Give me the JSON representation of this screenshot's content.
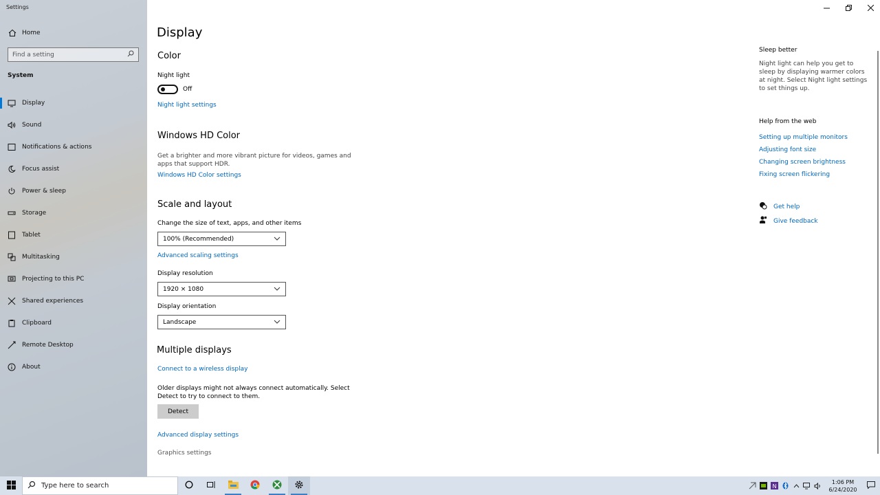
{
  "window": {
    "title": "Settings"
  },
  "sidebar": {
    "home_label": "Home",
    "search_placeholder": "Find a setting",
    "section_label": "System",
    "items": [
      {
        "label": "Display",
        "icon": "monitor-icon",
        "active": true
      },
      {
        "label": "Sound",
        "icon": "speaker-icon"
      },
      {
        "label": "Notifications & actions",
        "icon": "notification-icon"
      },
      {
        "label": "Focus assist",
        "icon": "moon-icon"
      },
      {
        "label": "Power & sleep",
        "icon": "power-icon"
      },
      {
        "label": "Storage",
        "icon": "storage-icon"
      },
      {
        "label": "Tablet",
        "icon": "tablet-icon"
      },
      {
        "label": "Multitasking",
        "icon": "multitasking-icon"
      },
      {
        "label": "Projecting to this PC",
        "icon": "projecting-icon"
      },
      {
        "label": "Shared experiences",
        "icon": "shared-icon"
      },
      {
        "label": "Clipboard",
        "icon": "clipboard-icon"
      },
      {
        "label": "Remote Desktop",
        "icon": "remote-icon"
      },
      {
        "label": "About",
        "icon": "info-icon"
      }
    ]
  },
  "main": {
    "page_title": "Display",
    "color": {
      "heading": "Color",
      "night_light_label": "Night light",
      "night_light_state": "Off",
      "night_light_link": "Night light settings"
    },
    "hd_color": {
      "heading": "Windows HD Color",
      "description": "Get a brighter and more vibrant picture for videos, games and apps that support HDR.",
      "link": "Windows HD Color settings"
    },
    "scale": {
      "heading": "Scale and layout",
      "size_label": "Change the size of text, apps, and other items",
      "size_value": "100% (Recommended)",
      "advanced_link": "Advanced scaling settings",
      "resolution_label": "Display resolution",
      "resolution_value": "1920 × 1080",
      "orientation_label": "Display orientation",
      "orientation_value": "Landscape"
    },
    "multiple": {
      "heading": "Multiple displays",
      "wireless_link": "Connect to a wireless display",
      "description": "Older displays might not always connect automatically. Select Detect to try to connect to them.",
      "detect_label": "Detect",
      "advanced_link": "Advanced display settings",
      "graphics_link": "Graphics settings"
    }
  },
  "right": {
    "sleep_heading": "Sleep better",
    "sleep_text": "Night light can help you get to sleep by displaying warmer colors at night. Select Night light settings to set things up.",
    "help_heading": "Help from the web",
    "help_links": [
      "Setting up multiple monitors",
      "Adjusting font size",
      "Changing screen brightness",
      "Fixing screen flickering"
    ],
    "get_help": "Get help",
    "give_feedback": "Give feedback"
  },
  "taskbar": {
    "search_placeholder": "Type here to search",
    "time": "1:06 PM",
    "date": "6/24/2020"
  },
  "colors": {
    "accent": "#0078d7",
    "link": "#0067c0"
  }
}
